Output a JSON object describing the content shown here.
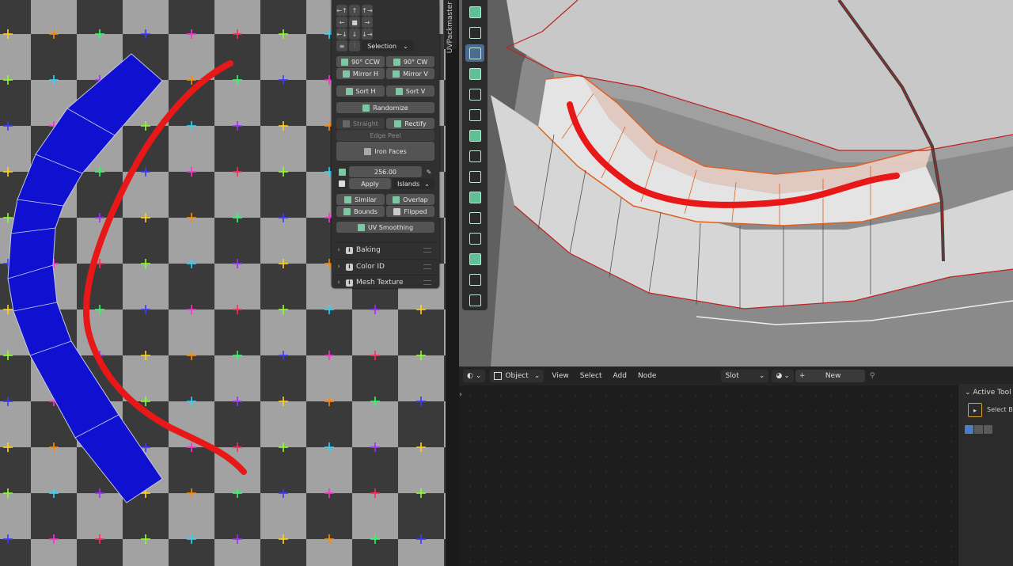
{
  "uv_panel": {
    "align_rows": [
      [
        "←↑",
        "↑",
        "↑→"
      ],
      [
        "←",
        "■",
        "→"
      ],
      [
        "←↓",
        "↓",
        "↓→"
      ]
    ],
    "selection_dropdown": "Selection",
    "rotate_ccw": "90° CCW",
    "rotate_cw": "90° CW",
    "mirror_h": "Mirror H",
    "mirror_v": "Mirror V",
    "sort_h": "Sort H",
    "sort_v": "Sort V",
    "randomize": "Randomize",
    "straight": "Straight",
    "rectify": "Rectify",
    "edge_peel": "Edge Peel",
    "iron_faces": "Iron Faces",
    "texel_value": "256.00",
    "apply": "Apply",
    "islands_dropdown": "Islands",
    "similar": "Similar",
    "overlap": "Overlap",
    "bounds": "Bounds",
    "flipped": "Flipped",
    "uv_smoothing": "UV Smoothing",
    "sections": [
      "Baking",
      "Color ID",
      "Mesh Texture"
    ],
    "sidebar_tab": "UVPackmaster"
  },
  "colors": {
    "uv_island_fill": "#1010d0",
    "stroke_red": "#e81818",
    "selected_tool": "#4b6b8f",
    "mesh_edge_orange": "#e06020"
  },
  "node_editor": {
    "object_mode": "Object",
    "menus": [
      "View",
      "Select",
      "Add",
      "Node"
    ],
    "slot_dropdown": "Slot",
    "new_button": "New",
    "active_tool_title": "Active Tool",
    "tool_name": "Select Bo"
  },
  "toolbar_tools": [
    "transform-icon",
    "measure-icon",
    "add-cube-icon",
    "extrude-icon",
    "inset-icon",
    "bevel-icon",
    "loop-cut-icon",
    "knife-icon",
    "poly-build-icon",
    "spin-icon",
    "smooth-icon",
    "edge-slide-icon",
    "shrink-fatten-icon",
    "shear-icon",
    "rip-icon"
  ]
}
